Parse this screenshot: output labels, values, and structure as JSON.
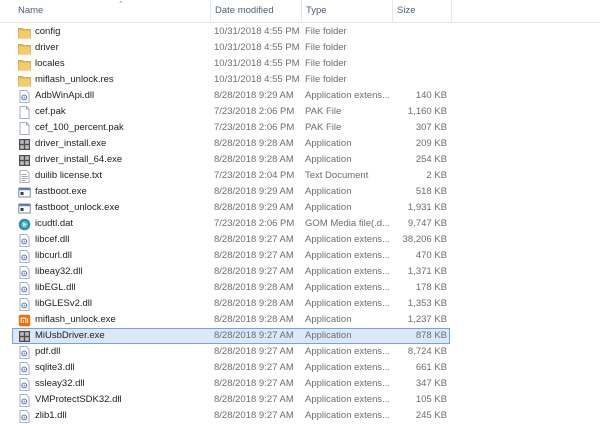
{
  "columns": {
    "name": "Name",
    "date": "Date modified",
    "type": "Type",
    "size": "Size"
  },
  "files": [
    {
      "name": "config",
      "date": "10/31/2018 4:55 PM",
      "type": "File folder",
      "size": "",
      "icon": "folder-icon"
    },
    {
      "name": "driver",
      "date": "10/31/2018 4:55 PM",
      "type": "File folder",
      "size": "",
      "icon": "folder-icon"
    },
    {
      "name": "locales",
      "date": "10/31/2018 4:55 PM",
      "type": "File folder",
      "size": "",
      "icon": "folder-icon"
    },
    {
      "name": "miflash_unlock.res",
      "date": "10/31/2018 4:55 PM",
      "type": "File folder",
      "size": "",
      "icon": "folder-icon"
    },
    {
      "name": "AdbWinApi.dll",
      "date": "8/28/2018 9:29 AM",
      "type": "Application extens...",
      "size": "140 KB",
      "icon": "dll-icon"
    },
    {
      "name": "cef.pak",
      "date": "7/23/2018 2:06 PM",
      "type": "PAK File",
      "size": "1,160 KB",
      "icon": "blank-file-icon"
    },
    {
      "name": "cef_100_percent.pak",
      "date": "7/23/2018 2:06 PM",
      "type": "PAK File",
      "size": "307 KB",
      "icon": "blank-file-icon"
    },
    {
      "name": "driver_install.exe",
      "date": "8/28/2018 9:28 AM",
      "type": "Application",
      "size": "209 KB",
      "icon": "installer-icon"
    },
    {
      "name": "driver_install_64.exe",
      "date": "8/28/2018 9:28 AM",
      "type": "Application",
      "size": "254 KB",
      "icon": "installer-icon"
    },
    {
      "name": "duilib license.txt",
      "date": "7/23/2018 2:04 PM",
      "type": "Text Document",
      "size": "2 KB",
      "icon": "text-file-icon"
    },
    {
      "name": "fastboot.exe",
      "date": "8/28/2018 9:29 AM",
      "type": "Application",
      "size": "518 KB",
      "icon": "app-window-icon"
    },
    {
      "name": "fastboot_unlock.exe",
      "date": "8/28/2018 9:29 AM",
      "type": "Application",
      "size": "1,931 KB",
      "icon": "app-window-icon"
    },
    {
      "name": "icudtl.dat",
      "date": "7/23/2018 2:06 PM",
      "type": "GOM Media file(.d...",
      "size": "9,747 KB",
      "icon": "media-file-icon"
    },
    {
      "name": "libcef.dll",
      "date": "8/28/2018 9:27 AM",
      "type": "Application extens...",
      "size": "38,206 KB",
      "icon": "dll-icon"
    },
    {
      "name": "libcurl.dll",
      "date": "8/28/2018 9:27 AM",
      "type": "Application extens...",
      "size": "470 KB",
      "icon": "dll-icon"
    },
    {
      "name": "libeay32.dll",
      "date": "8/28/2018 9:27 AM",
      "type": "Application extens...",
      "size": "1,371 KB",
      "icon": "dll-icon"
    },
    {
      "name": "libEGL.dll",
      "date": "8/28/2018 9:28 AM",
      "type": "Application extens...",
      "size": "178 KB",
      "icon": "dll-icon"
    },
    {
      "name": "libGLESv2.dll",
      "date": "8/28/2018 9:28 AM",
      "type": "Application extens...",
      "size": "1,353 KB",
      "icon": "dll-icon"
    },
    {
      "name": "miflash_unlock.exe",
      "date": "8/28/2018 9:28 AM",
      "type": "Application",
      "size": "1,237 KB",
      "icon": "miflash-app-icon"
    },
    {
      "name": "MiUsbDriver.exe",
      "date": "8/28/2018 9:27 AM",
      "type": "Application",
      "size": "878 KB",
      "icon": "installer-icon",
      "selected": true
    },
    {
      "name": "pdf.dll",
      "date": "8/28/2018 9:27 AM",
      "type": "Application extens...",
      "size": "8,724 KB",
      "icon": "dll-icon"
    },
    {
      "name": "sqlite3.dll",
      "date": "8/28/2018 9:27 AM",
      "type": "Application extens...",
      "size": "661 KB",
      "icon": "dll-icon"
    },
    {
      "name": "ssleay32.dll",
      "date": "8/28/2018 9:27 AM",
      "type": "Application extens...",
      "size": "347 KB",
      "icon": "dll-icon"
    },
    {
      "name": "VMProtectSDK32.dll",
      "date": "8/28/2018 9:27 AM",
      "type": "Application extens...",
      "size": "105 KB",
      "icon": "dll-icon"
    },
    {
      "name": "zlib1.dll",
      "date": "8/28/2018 9:27 AM",
      "type": "Application extens...",
      "size": "245 KB",
      "icon": "dll-icon"
    }
  ],
  "colors": {
    "selection_bg": "#d9e8fb",
    "selection_border": "#7da2ce",
    "folder": "#e8b94a",
    "header_text": "#4c607a"
  }
}
